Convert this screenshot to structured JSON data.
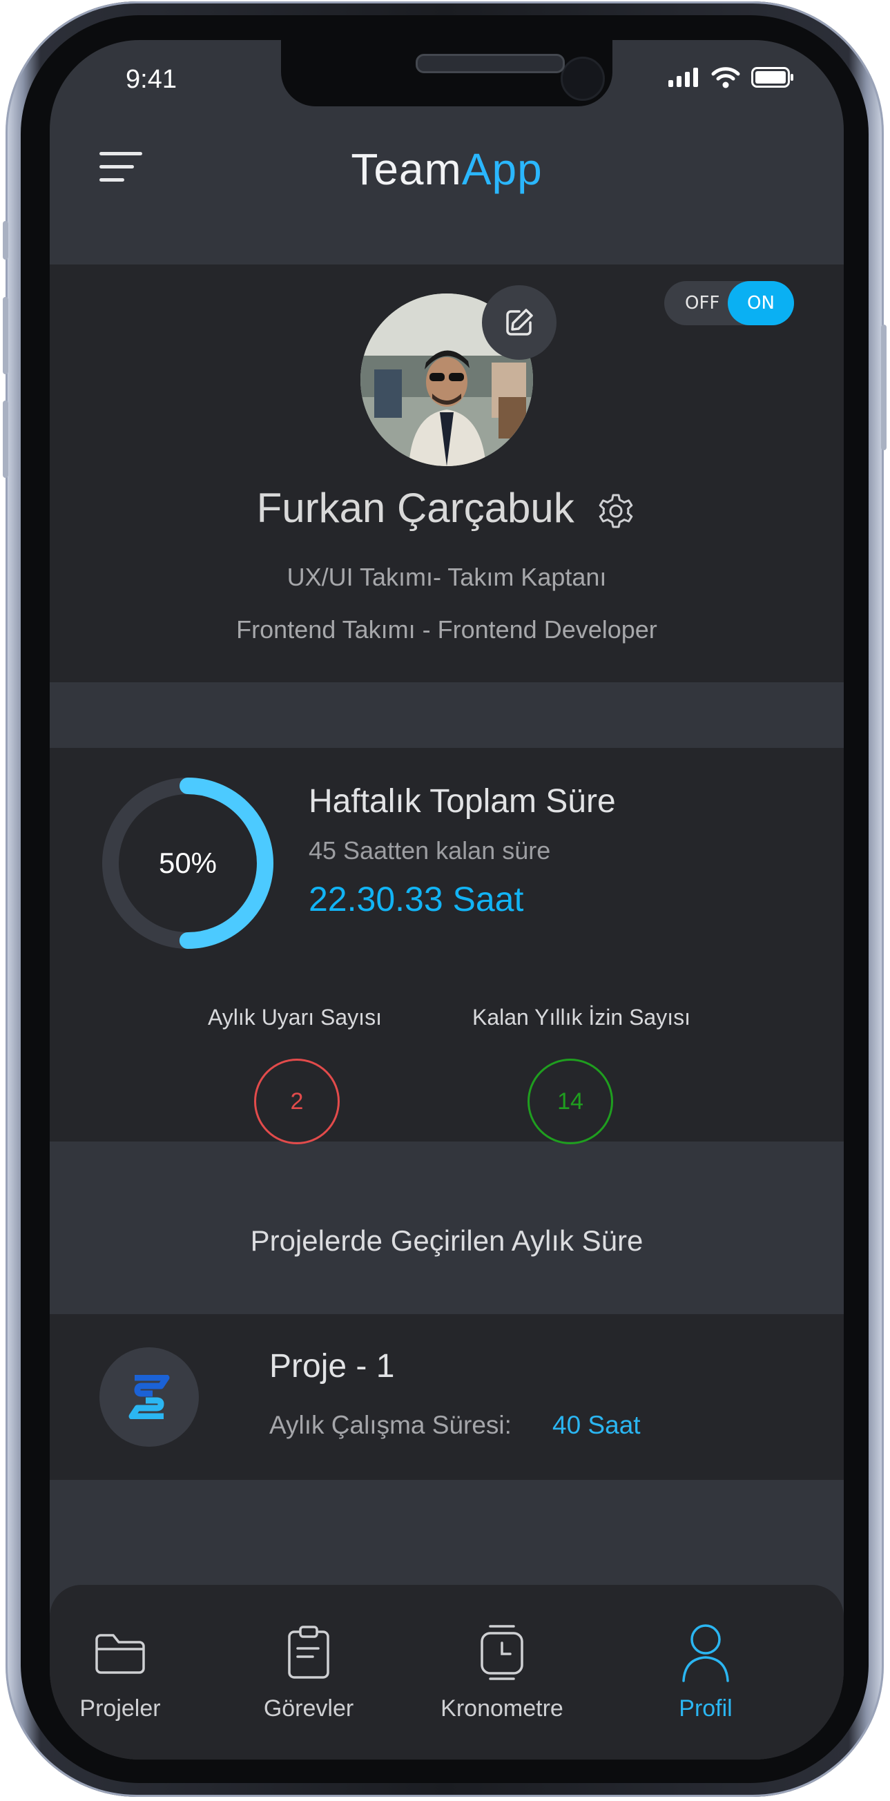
{
  "status_bar": {
    "time": "9:41"
  },
  "header": {
    "logo_part1": "Team",
    "logo_part2": "App",
    "menu_icon": "hamburger-menu-icon"
  },
  "profile": {
    "toggle": {
      "off_label": "OFF",
      "on_label": "ON",
      "state": "on"
    },
    "name": "Furkan Çarçabuk",
    "roles": [
      "UX/UI Takımı- Takım Kaptanı",
      "Frontend Takımı - Frontend Developer"
    ],
    "edit_icon": "edit-icon",
    "settings_icon": "gear-icon"
  },
  "weekly": {
    "progress_label": "50%",
    "progress": 0.5,
    "title": "Haftalık Toplam Süre",
    "subtitle": "45 Saatten kalan süre",
    "value": "22.30.33 Saat"
  },
  "stats": {
    "warnings_label": "Aylık Uyarı Sayısı",
    "warnings_value": "2",
    "leave_label": "Kalan Yıllık İzin Sayısı",
    "leave_value": "14"
  },
  "projects": {
    "section_title": "Projelerde Geçirilen Aylık Süre",
    "items": [
      {
        "name": "Proje - 1",
        "label": "Aylık Çalışma Süresi:",
        "value": "40 Saat"
      }
    ]
  },
  "tabbar": {
    "items": [
      {
        "label": "Projeler",
        "icon": "folder-icon",
        "active": false
      },
      {
        "label": "Görevler",
        "icon": "clipboard-icon",
        "active": false
      },
      {
        "label": "Kronometre",
        "icon": "stopwatch-icon",
        "active": false
      },
      {
        "label": "Profil",
        "icon": "user-icon",
        "active": true
      }
    ]
  },
  "colors": {
    "accent": "#0AB0F3",
    "warning": "#E24B4B",
    "success": "#1F9E1F",
    "card": "#25262A",
    "background": "#33363D"
  }
}
